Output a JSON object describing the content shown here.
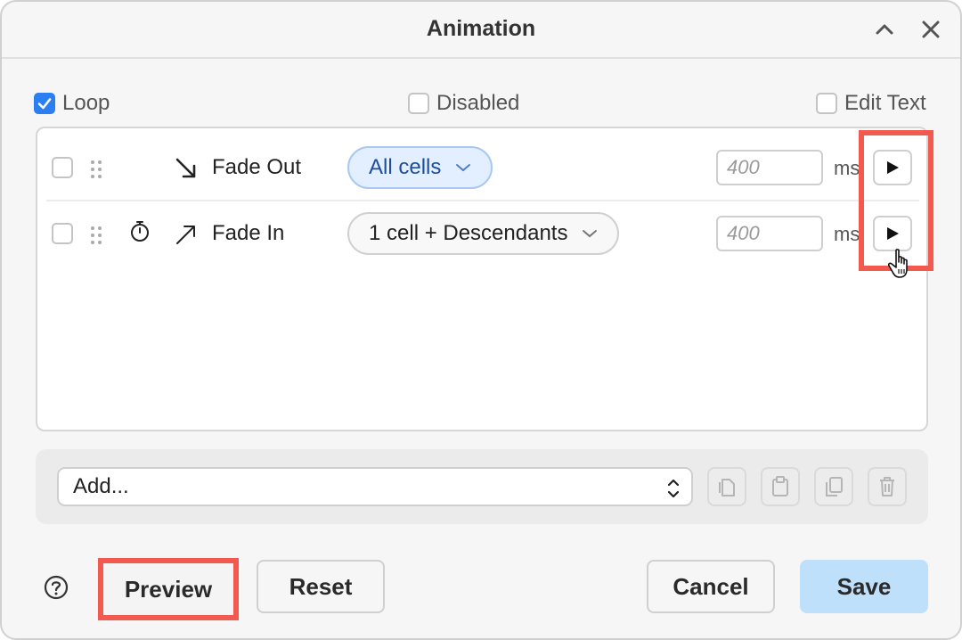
{
  "window": {
    "title": "Animation"
  },
  "options": {
    "loop": {
      "label": "Loop",
      "checked": true
    },
    "disabled": {
      "label": "Disabled",
      "checked": false
    },
    "edit_text": {
      "label": "Edit Text",
      "checked": false
    }
  },
  "steps": [
    {
      "effect": "Fade Out",
      "direction_icon": "arrow-down-right-icon",
      "has_timer": false,
      "target": "All cells",
      "target_selected": true,
      "duration_placeholder": "400",
      "unit": "ms",
      "checked": false
    },
    {
      "effect": "Fade In",
      "direction_icon": "arrow-up-right-icon",
      "has_timer": true,
      "target": "1 cell + Descendants",
      "target_selected": false,
      "duration_placeholder": "400",
      "unit": "ms",
      "checked": false
    }
  ],
  "add_panel": {
    "select_value": "Add...",
    "tools": [
      "copy-icon",
      "paste-icon",
      "duplicate-icon",
      "trash-icon"
    ]
  },
  "footer": {
    "preview_label": "Preview",
    "reset_label": "Reset",
    "cancel_label": "Cancel",
    "save_label": "Save"
  },
  "colors": {
    "accent": "#2b7ff0",
    "highlight": "#f25a50",
    "save_bg": "#bfe0fb",
    "selected_pill_bg": "#e3efff"
  }
}
